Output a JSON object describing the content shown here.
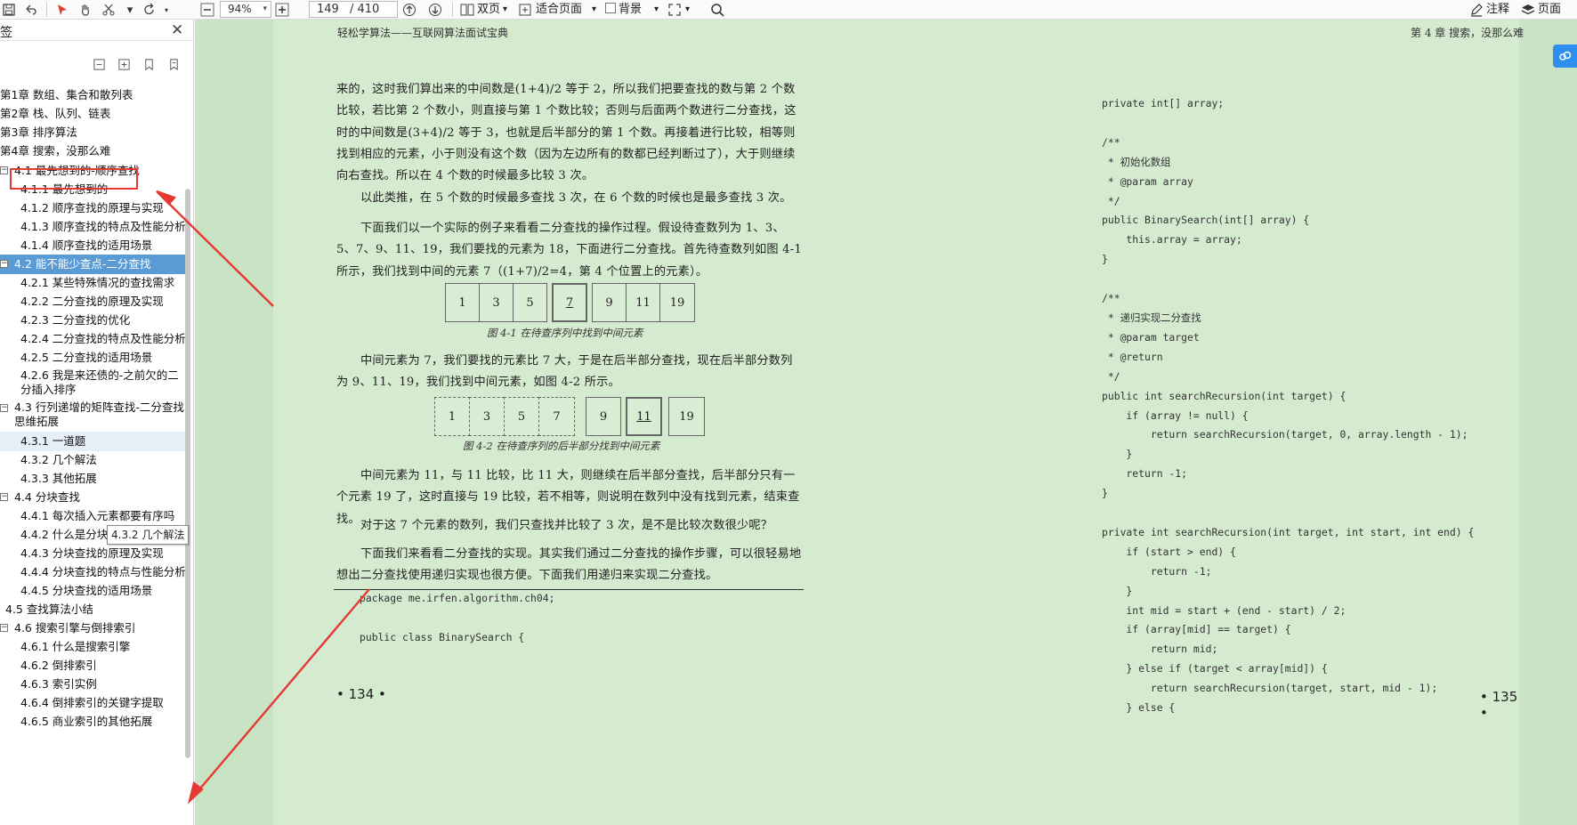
{
  "toolbar": {
    "zoom_value": "94%",
    "page_current": "149",
    "page_total": "/ 410",
    "dual_page_label": "双页",
    "fit_page_label": "适合页面",
    "background_label": "背景",
    "annotate_label": "注释",
    "page_label": "页面"
  },
  "sidebar": {
    "title": "签",
    "tooltip": "4.3.2 几个解法",
    "items": [
      {
        "label": "第1章  数组、集合和散列表"
      },
      {
        "label": "第2章  栈、队列、链表"
      },
      {
        "label": "第3章  排序算法"
      },
      {
        "label": "第4章  搜索，没那么难"
      },
      {
        "label": "4.1  最先想到的-顺序查找"
      },
      {
        "label": "4.1.1  最先想到的"
      },
      {
        "label": "4.1.2  顺序查找的原理与实现"
      },
      {
        "label": "4.1.3  顺序查找的特点及性能分析"
      },
      {
        "label": "4.1.4  顺序查找的适用场景"
      },
      {
        "label": "4.2  能不能少查点-二分查找"
      },
      {
        "label": "4.2.1  某些特殊情况的查找需求"
      },
      {
        "label": "4.2.2  二分查找的原理及实现"
      },
      {
        "label": "4.2.3  二分查找的优化"
      },
      {
        "label": "4.2.4  二分查找的特点及性能分析"
      },
      {
        "label": "4.2.5  二分查找的适用场景"
      },
      {
        "label": "4.2.6  我是来还债的-之前欠的二分插入排序"
      },
      {
        "label": "4.3  行列递增的矩阵查找-二分查找思维拓展"
      },
      {
        "label": "4.3.1  一道题"
      },
      {
        "label": "4.3.2  几个解法"
      },
      {
        "label": "4.3.3  其他拓展"
      },
      {
        "label": "4.4  分块查找"
      },
      {
        "label": "4.4.1  每次插入元素都要有序吗"
      },
      {
        "label": "4.4.2  什么是分块查找"
      },
      {
        "label": "4.4.3  分块查找的原理及实现"
      },
      {
        "label": "4.4.4  分块查找的特点与性能分析"
      },
      {
        "label": "4.4.5  分块查找的适用场景"
      },
      {
        "label": "4.5  查找算法小结"
      },
      {
        "label": "4.6  搜索引擎与倒排索引"
      },
      {
        "label": "4.6.1  什么是搜索引擎"
      },
      {
        "label": "4.6.2  倒排索引"
      },
      {
        "label": "4.6.3  索引实例"
      },
      {
        "label": "4.6.4  倒排索引的关键字提取"
      },
      {
        "label": "4.6.5  商业索引的其他拓展"
      }
    ]
  },
  "left_page": {
    "running_head": "轻松学算法——互联网算法面试宝典",
    "p1": "来的，这时我们算出来的中间数是(1+4)/2 等于 2，所以我们把要查找的数与第 2 个数比较，若比第 2 个数小，则直接与第 1 个数比较；否则与后面两个数进行二分查找，这时的中间数是(3+4)/2 等于 3，也就是后半部分的第 1 个数。再接着进行比较，相等则找到相应的元素，小于则没有这个数（因为左边所有的数都已经判断过了），大于则继续向右查找。所以在 4 个数的时候最多比较 3 次。",
    "p2": "以此类推，在 5 个数的时候最多查找 3 次，在 6 个数的时候也是最多查找 3 次。",
    "p3": "下面我们以一个实际的例子来看看二分查找的操作过程。假设待查数列为 1、3、5、7、9、11、19，我们要找的元素为 18，下面进行二分查找。首先待查数列如图 4-1 所示，我们找到中间的元素 7（(1+7)/2=4，第 4 个位置上的元素）。",
    "fig1_cells": [
      "1",
      "3",
      "5",
      "7",
      "9",
      "11",
      "19"
    ],
    "fig1_caption": "图 4-1    在待查序列中找到中间元素",
    "p4": "中间元素为 7，我们要找的元素比 7 大，于是在后半部分查找，现在后半部分数列为 9、11、19，我们找到中间元素，如图 4-2 所示。",
    "fig2_cells": [
      "1",
      "3",
      "5",
      "7",
      "9",
      "11",
      "19"
    ],
    "fig2_caption": "图 4-2    在待查序列的后半部分找到中间元素",
    "p5": "中间元素为 11，与 11 比较，比 11 大，则继续在后半部分查找，后半部分只有一个元素 19 了，这时直接与 19 比较，若不相等，则说明在数列中没有找到元素，结束查找。",
    "p6": "对于这 7 个元素的数列，我们只查找并比较了 3 次，是不是比较次数很少呢？",
    "p7": "下面我们来看看二分查找的实现。其实我们通过二分查找的操作步骤，可以很轻易地想出二分查找使用递归实现也很方便。下面我们用递归来实现二分查找。",
    "code": "package me.irfen.algorithm.ch04;\n\npublic class BinarySearch {",
    "page_number": "• 134 •"
  },
  "right_page": {
    "running_head": "第 4 章   搜索，没那么难",
    "code": "private int[] array;\n\n/**\n * 初始化数组\n * @param array\n */\npublic BinarySearch(int[] array) {\n    this.array = array;\n}\n\n/**\n * 递归实现二分查找\n * @param target\n * @return\n */\npublic int searchRecursion(int target) {\n    if (array != null) {\n        return searchRecursion(target, 0, array.length - 1);\n    }\n    return -1;\n}\n\nprivate int searchRecursion(int target, int start, int end) {\n    if (start > end) {\n        return -1;\n    }\n    int mid = start + (end - start) / 2;\n    if (array[mid] == target) {\n        return mid;\n    } else if (target < array[mid]) {\n        return searchRecursion(target, start, mid - 1);\n    } else {",
    "page_number": "• 135 •"
  },
  "colors": {
    "page_bg": "#d5ebd0",
    "selected": "#5b9bd5",
    "annotation_red": "#e53935",
    "cloud_button": "#2f8ff0"
  }
}
